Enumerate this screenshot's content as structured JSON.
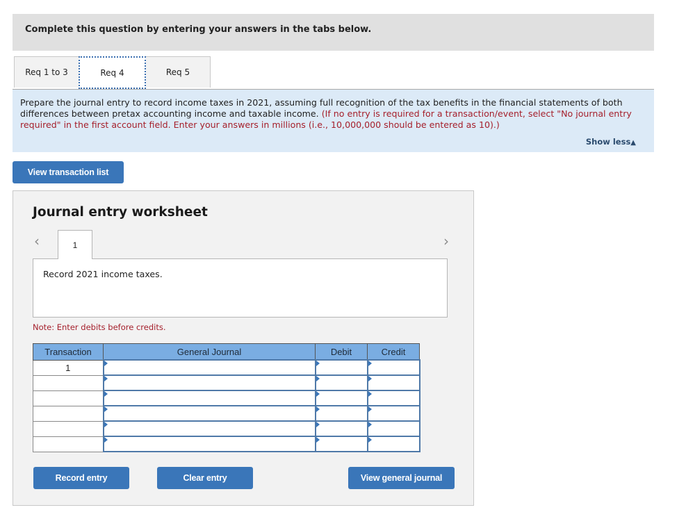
{
  "banner": {
    "text": "Complete this question by entering your answers in the tabs below."
  },
  "tabs": [
    {
      "label": "Req 1 to 3",
      "active": false
    },
    {
      "label": "Req 4",
      "active": true
    },
    {
      "label": "Req 5",
      "active": false
    }
  ],
  "instructions": {
    "main": "Prepare the journal entry to record income taxes in 2021, assuming full recognition of the tax benefits in the financial statements of both differences between pretax accounting income and taxable income. ",
    "red": "(If no entry is required for a transaction/event, select \"No journal entry required\" in the first account field. Enter your answers in millions (i.e., 10,000,000 should be entered as 10).)",
    "show_less": "Show less",
    "show_less_icon": "▲"
  },
  "view_transaction_list": "View transaction list",
  "worksheet": {
    "title": "Journal entry worksheet",
    "nav_prev": "‹",
    "nav_next": "›",
    "entry_tab": "1",
    "description": "Record 2021 income taxes.",
    "note": "Note: Enter debits before credits.",
    "table": {
      "headers": [
        "Transaction",
        "General Journal",
        "Debit",
        "Credit"
      ],
      "rows": [
        {
          "transaction": "1",
          "account": "",
          "debit": "",
          "credit": ""
        },
        {
          "transaction": "",
          "account": "",
          "debit": "",
          "credit": ""
        },
        {
          "transaction": "",
          "account": "",
          "debit": "",
          "credit": ""
        },
        {
          "transaction": "",
          "account": "",
          "debit": "",
          "credit": ""
        },
        {
          "transaction": "",
          "account": "",
          "debit": "",
          "credit": ""
        },
        {
          "transaction": "",
          "account": "",
          "debit": "",
          "credit": ""
        }
      ]
    },
    "buttons": {
      "record": "Record entry",
      "clear": "Clear entry",
      "view_general_journal": "View general journal"
    }
  },
  "colors": {
    "accent_button": "#3a76b9",
    "table_header": "#7aade2",
    "instructions_bg": "#dceaf7",
    "note_red": "#a5202c"
  }
}
